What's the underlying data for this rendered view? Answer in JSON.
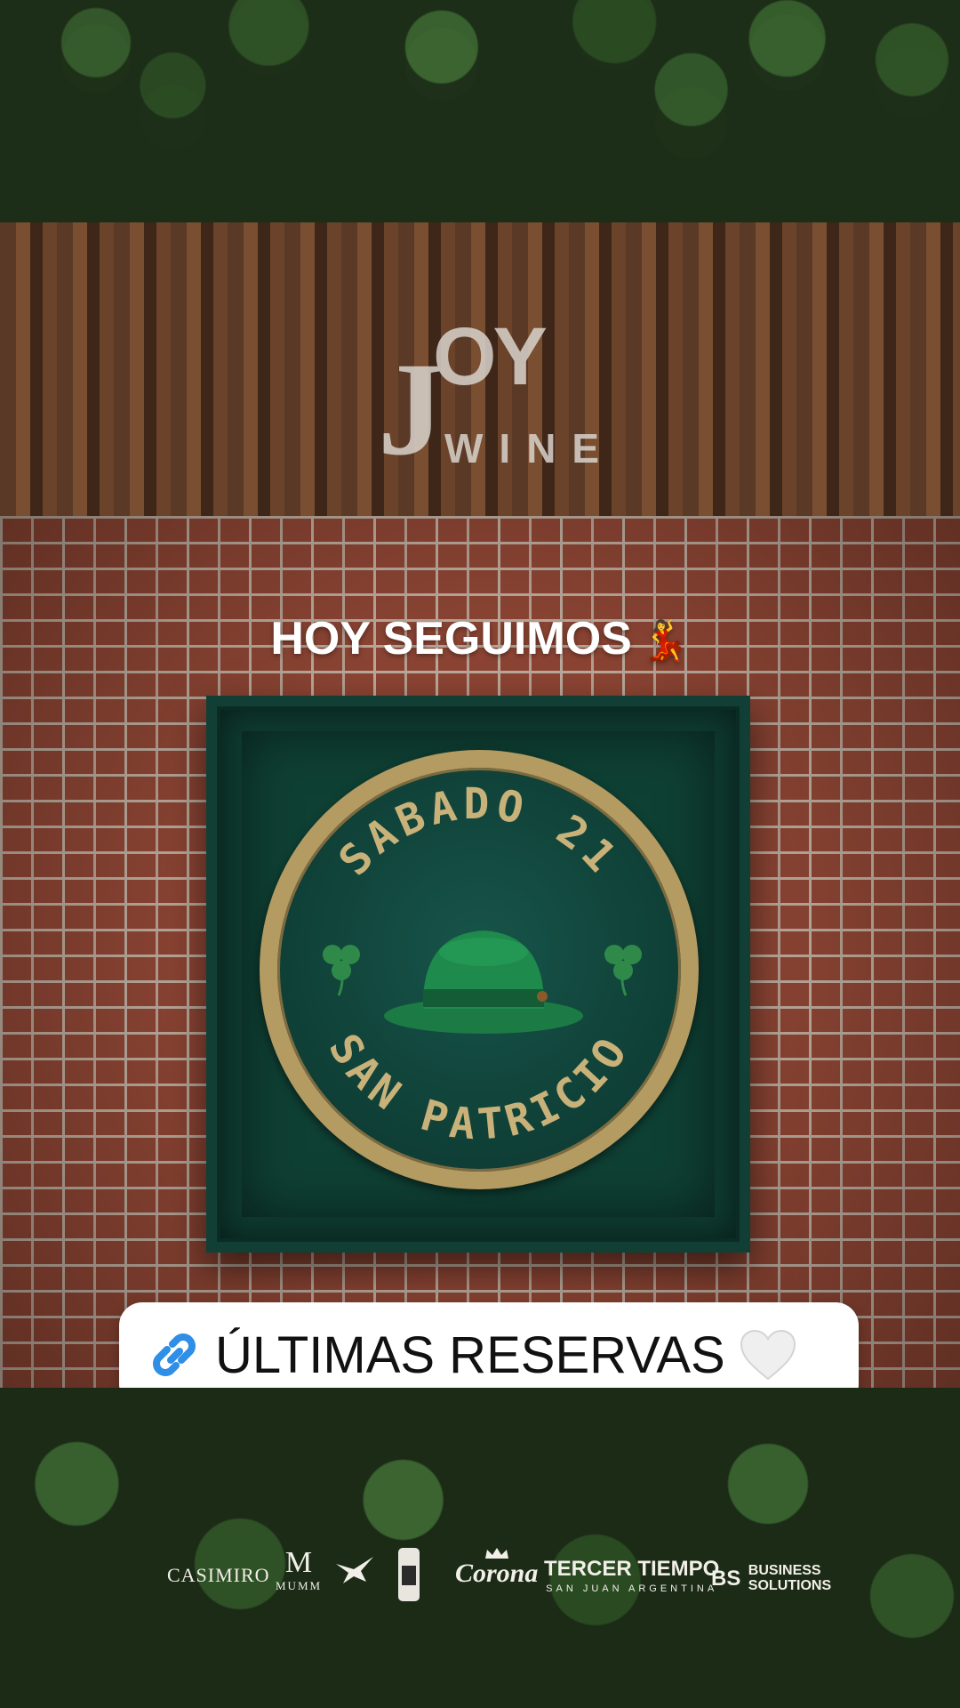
{
  "story": {
    "headline": "HOY SEGUIMOS",
    "headline_emoji": "💃",
    "reserve_label": "ÚLTIMAS RESERVAS",
    "reserve_emoji": "🤍"
  },
  "logo": {
    "initial": "J",
    "letters": "OY",
    "sub": "WINE"
  },
  "sign": {
    "top_text": "SABADO 21",
    "bottom_text": "SAN PATRICIO"
  },
  "sponsors": {
    "casimiro": "CASIMIRO",
    "mumm_mark": "M",
    "mumm_name": "MUMM",
    "corona": "Corona",
    "tercer_tiempo": "TERCER TIEMPO",
    "tercer_tiempo_sub": "SAN JUAN ARGENTINA",
    "business_mark": "BS",
    "business_line1": "BUSINESS",
    "business_line2": "SOLUTIONS"
  },
  "colors": {
    "sign_green": "#0f4034",
    "gold": "#c8b27a",
    "brick": "#8b4433",
    "link_blue": "#2f8ee6"
  }
}
